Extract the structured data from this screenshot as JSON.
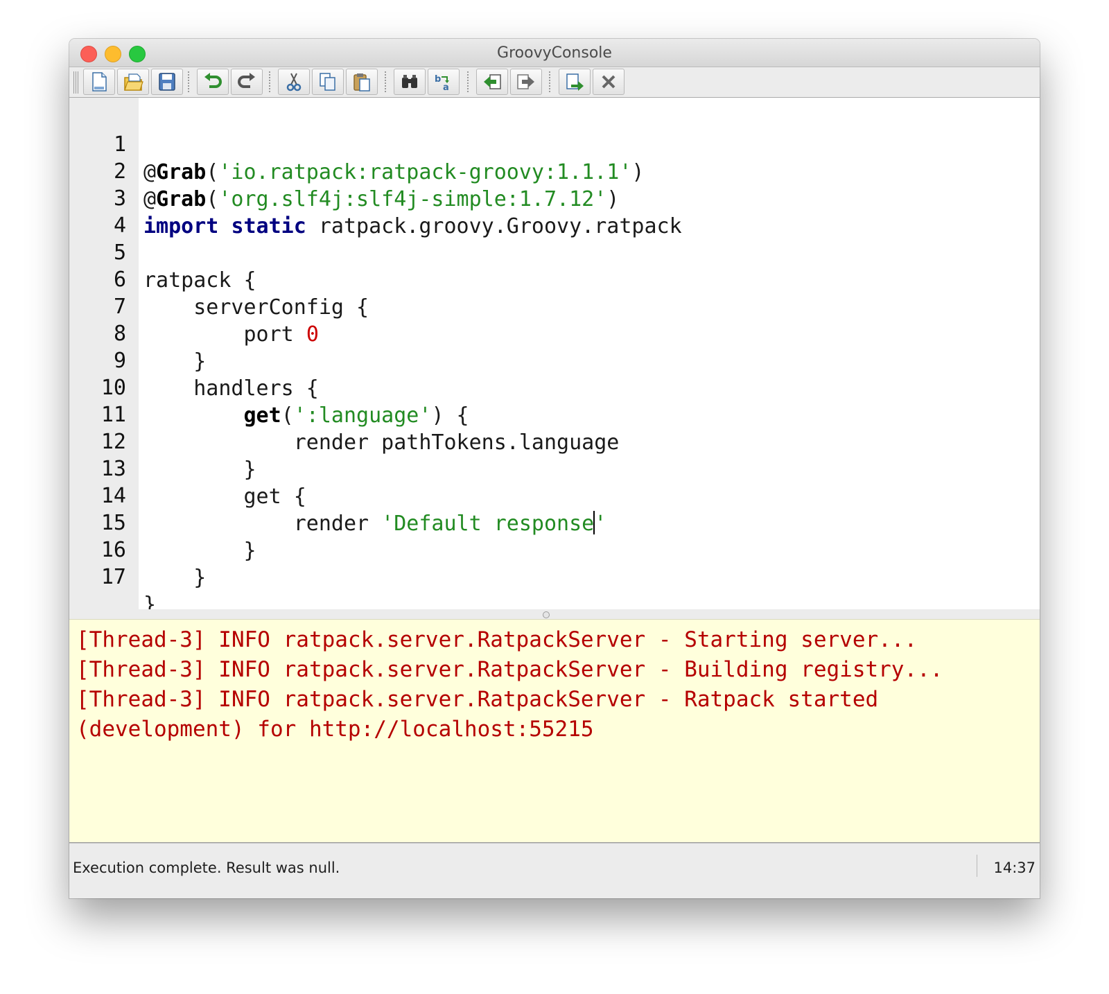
{
  "window": {
    "title": "GroovyConsole"
  },
  "toolbar": {
    "buttons": [
      {
        "name": "new-file",
        "icon": "new-file-icon"
      },
      {
        "name": "open-file",
        "icon": "open-folder-icon"
      },
      {
        "name": "save",
        "icon": "save-disk-icon"
      },
      {
        "name": "undo",
        "icon": "undo-icon"
      },
      {
        "name": "redo",
        "icon": "redo-icon"
      },
      {
        "name": "cut",
        "icon": "scissors-icon"
      },
      {
        "name": "copy",
        "icon": "copy-icon"
      },
      {
        "name": "paste",
        "icon": "paste-icon"
      },
      {
        "name": "find",
        "icon": "binoculars-icon"
      },
      {
        "name": "replace",
        "icon": "replace-icon"
      },
      {
        "name": "history-previous",
        "icon": "history-back-icon"
      },
      {
        "name": "history-next",
        "icon": "history-forward-icon"
      },
      {
        "name": "run-script",
        "icon": "run-icon"
      },
      {
        "name": "interrupt",
        "icon": "close-x-icon"
      }
    ]
  },
  "editor": {
    "line_numbers": [
      "1",
      "2",
      "3",
      "4",
      "5",
      "6",
      "7",
      "8",
      "9",
      "10",
      "11",
      "12",
      "13",
      "14",
      "15",
      "16",
      "17"
    ],
    "lines": {
      "l1": {
        "at": "@",
        "ann": "Grab",
        "open": "(",
        "str": "'io.ratpack:ratpack-groovy:1.1.1'",
        "close": ")"
      },
      "l2": {
        "at": "@",
        "ann": "Grab",
        "open": "(",
        "str": "'org.slf4j:slf4j-simple:1.7.12'",
        "close": ")"
      },
      "l3": {
        "kw1": "import",
        "kw2": "static",
        "rest": "ratpack.groovy.Groovy.ratpack"
      },
      "l5": "ratpack {",
      "l6": "    serverConfig {",
      "l7": {
        "text": "        port ",
        "num": "0"
      },
      "l8": "    }",
      "l9": "    handlers {",
      "l10": {
        "indent": "        ",
        "kw": "get",
        "open": "(",
        "str": "':language'",
        "rest": ") {"
      },
      "l11": "            render pathTokens.language",
      "l12": "        }",
      "l13": "        get {",
      "l14": {
        "text": "            render ",
        "str_a": "'Default response",
        "str_b": "'"
      },
      "l15": "        }",
      "l16": "    }",
      "l17": "}"
    }
  },
  "output": {
    "lines": [
      "[Thread-3] INFO ratpack.server.RatpackServer - Starting server...",
      "[Thread-3] INFO ratpack.server.RatpackServer - Building registry...",
      "[Thread-3] INFO ratpack.server.RatpackServer - Ratpack started",
      "(development) for http://localhost:55215"
    ],
    "text_color": "#b50000",
    "background_color": "#ffffdc"
  },
  "status": {
    "message": "Execution complete. Result was null.",
    "cursor_position": "14:37"
  }
}
